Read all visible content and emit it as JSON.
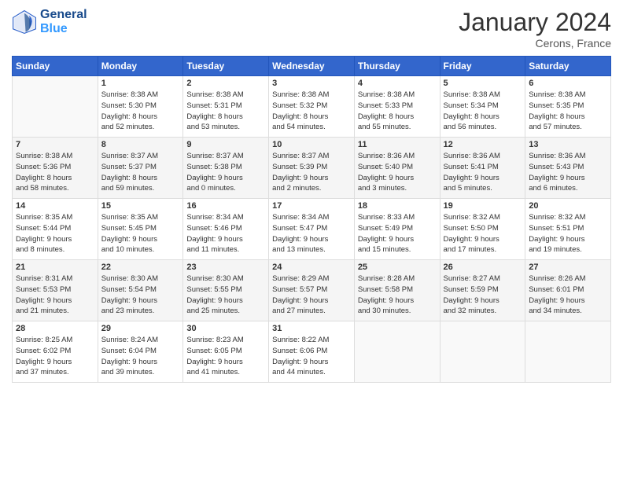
{
  "logo": {
    "text_general": "General",
    "text_blue": "Blue"
  },
  "header": {
    "month_year": "January 2024",
    "location": "Cerons, France"
  },
  "days_of_week": [
    "Sunday",
    "Monday",
    "Tuesday",
    "Wednesday",
    "Thursday",
    "Friday",
    "Saturday"
  ],
  "weeks": [
    [
      {
        "day": "",
        "sunrise": "",
        "sunset": "",
        "daylight_hours": "",
        "daylight_minutes": ""
      },
      {
        "day": "1",
        "sunrise": "8:38 AM",
        "sunset": "5:30 PM",
        "daylight_hours": "8",
        "daylight_minutes": "52"
      },
      {
        "day": "2",
        "sunrise": "8:38 AM",
        "sunset": "5:31 PM",
        "daylight_hours": "8",
        "daylight_minutes": "53"
      },
      {
        "day": "3",
        "sunrise": "8:38 AM",
        "sunset": "5:32 PM",
        "daylight_hours": "8",
        "daylight_minutes": "54"
      },
      {
        "day": "4",
        "sunrise": "8:38 AM",
        "sunset": "5:33 PM",
        "daylight_hours": "8",
        "daylight_minutes": "55"
      },
      {
        "day": "5",
        "sunrise": "8:38 AM",
        "sunset": "5:34 PM",
        "daylight_hours": "8",
        "daylight_minutes": "56"
      },
      {
        "day": "6",
        "sunrise": "8:38 AM",
        "sunset": "5:35 PM",
        "daylight_hours": "8",
        "daylight_minutes": "57"
      }
    ],
    [
      {
        "day": "7",
        "sunrise": "8:38 AM",
        "sunset": "5:36 PM",
        "daylight_hours": "8",
        "daylight_minutes": "58"
      },
      {
        "day": "8",
        "sunrise": "8:37 AM",
        "sunset": "5:37 PM",
        "daylight_hours": "8",
        "daylight_minutes": "59"
      },
      {
        "day": "9",
        "sunrise": "8:37 AM",
        "sunset": "5:38 PM",
        "daylight_hours": "9",
        "daylight_minutes": "0"
      },
      {
        "day": "10",
        "sunrise": "8:37 AM",
        "sunset": "5:39 PM",
        "daylight_hours": "9",
        "daylight_minutes": "2"
      },
      {
        "day": "11",
        "sunrise": "8:36 AM",
        "sunset": "5:40 PM",
        "daylight_hours": "9",
        "daylight_minutes": "3"
      },
      {
        "day": "12",
        "sunrise": "8:36 AM",
        "sunset": "5:41 PM",
        "daylight_hours": "9",
        "daylight_minutes": "5"
      },
      {
        "day": "13",
        "sunrise": "8:36 AM",
        "sunset": "5:43 PM",
        "daylight_hours": "9",
        "daylight_minutes": "6"
      }
    ],
    [
      {
        "day": "14",
        "sunrise": "8:35 AM",
        "sunset": "5:44 PM",
        "daylight_hours": "9",
        "daylight_minutes": "8"
      },
      {
        "day": "15",
        "sunrise": "8:35 AM",
        "sunset": "5:45 PM",
        "daylight_hours": "9",
        "daylight_minutes": "10"
      },
      {
        "day": "16",
        "sunrise": "8:34 AM",
        "sunset": "5:46 PM",
        "daylight_hours": "9",
        "daylight_minutes": "11"
      },
      {
        "day": "17",
        "sunrise": "8:34 AM",
        "sunset": "5:47 PM",
        "daylight_hours": "9",
        "daylight_minutes": "13"
      },
      {
        "day": "18",
        "sunrise": "8:33 AM",
        "sunset": "5:49 PM",
        "daylight_hours": "9",
        "daylight_minutes": "15"
      },
      {
        "day": "19",
        "sunrise": "8:32 AM",
        "sunset": "5:50 PM",
        "daylight_hours": "9",
        "daylight_minutes": "17"
      },
      {
        "day": "20",
        "sunrise": "8:32 AM",
        "sunset": "5:51 PM",
        "daylight_hours": "9",
        "daylight_minutes": "19"
      }
    ],
    [
      {
        "day": "21",
        "sunrise": "8:31 AM",
        "sunset": "5:53 PM",
        "daylight_hours": "9",
        "daylight_minutes": "21"
      },
      {
        "day": "22",
        "sunrise": "8:30 AM",
        "sunset": "5:54 PM",
        "daylight_hours": "9",
        "daylight_minutes": "23"
      },
      {
        "day": "23",
        "sunrise": "8:30 AM",
        "sunset": "5:55 PM",
        "daylight_hours": "9",
        "daylight_minutes": "25"
      },
      {
        "day": "24",
        "sunrise": "8:29 AM",
        "sunset": "5:57 PM",
        "daylight_hours": "9",
        "daylight_minutes": "27"
      },
      {
        "day": "25",
        "sunrise": "8:28 AM",
        "sunset": "5:58 PM",
        "daylight_hours": "9",
        "daylight_minutes": "30"
      },
      {
        "day": "26",
        "sunrise": "8:27 AM",
        "sunset": "5:59 PM",
        "daylight_hours": "9",
        "daylight_minutes": "32"
      },
      {
        "day": "27",
        "sunrise": "8:26 AM",
        "sunset": "6:01 PM",
        "daylight_hours": "9",
        "daylight_minutes": "34"
      }
    ],
    [
      {
        "day": "28",
        "sunrise": "8:25 AM",
        "sunset": "6:02 PM",
        "daylight_hours": "9",
        "daylight_minutes": "37"
      },
      {
        "day": "29",
        "sunrise": "8:24 AM",
        "sunset": "6:04 PM",
        "daylight_hours": "9",
        "daylight_minutes": "39"
      },
      {
        "day": "30",
        "sunrise": "8:23 AM",
        "sunset": "6:05 PM",
        "daylight_hours": "9",
        "daylight_minutes": "41"
      },
      {
        "day": "31",
        "sunrise": "8:22 AM",
        "sunset": "6:06 PM",
        "daylight_hours": "9",
        "daylight_minutes": "44"
      },
      {
        "day": "",
        "sunrise": "",
        "sunset": "",
        "daylight_hours": "",
        "daylight_minutes": ""
      },
      {
        "day": "",
        "sunrise": "",
        "sunset": "",
        "daylight_hours": "",
        "daylight_minutes": ""
      },
      {
        "day": "",
        "sunrise": "",
        "sunset": "",
        "daylight_hours": "",
        "daylight_minutes": ""
      }
    ]
  ]
}
